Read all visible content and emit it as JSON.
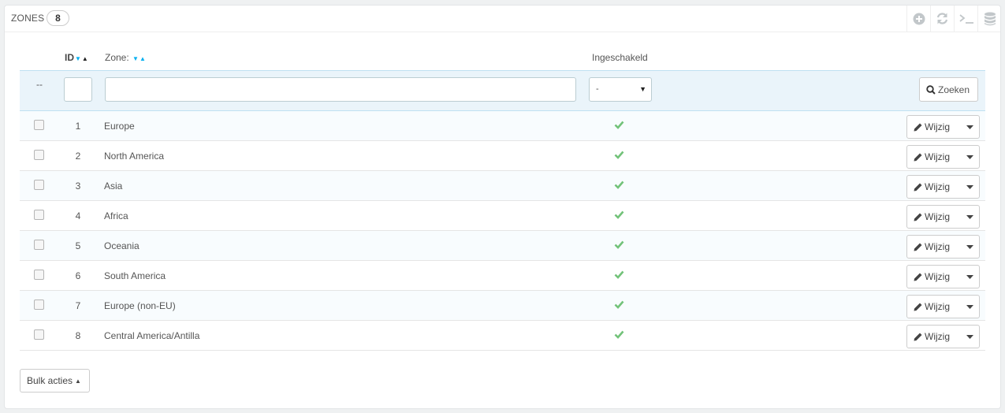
{
  "panel": {
    "title": "ZONES",
    "count": "8"
  },
  "toolbar": [
    {
      "name": "add-icon"
    },
    {
      "name": "refresh-icon"
    },
    {
      "name": "sql-console-icon"
    },
    {
      "name": "database-icon"
    }
  ],
  "columns": {
    "id": "ID",
    "zone": "Zone:",
    "enabled": "Ingeschakeld"
  },
  "filters": {
    "dashes": "--",
    "select_value": "-",
    "search_label": "Zoeken"
  },
  "rows": [
    {
      "id": "1",
      "zone": "Europe",
      "enabled": true,
      "edit_label": "Wijzig"
    },
    {
      "id": "2",
      "zone": "North America",
      "enabled": true,
      "edit_label": "Wijzig"
    },
    {
      "id": "3",
      "zone": "Asia",
      "enabled": true,
      "edit_label": "Wijzig"
    },
    {
      "id": "4",
      "zone": "Africa",
      "enabled": true,
      "edit_label": "Wijzig"
    },
    {
      "id": "5",
      "zone": "Oceania",
      "enabled": true,
      "edit_label": "Wijzig"
    },
    {
      "id": "6",
      "zone": "South America",
      "enabled": true,
      "edit_label": "Wijzig"
    },
    {
      "id": "7",
      "zone": "Europe (non-EU)",
      "enabled": true,
      "edit_label": "Wijzig"
    },
    {
      "id": "8",
      "zone": "Central America/Antilla",
      "enabled": true,
      "edit_label": "Wijzig"
    }
  ],
  "bulk": {
    "label": "Bulk acties"
  },
  "colors": {
    "accent": "#00aff0",
    "check": "#72c279",
    "filter_bg": "#eaf4fa"
  }
}
